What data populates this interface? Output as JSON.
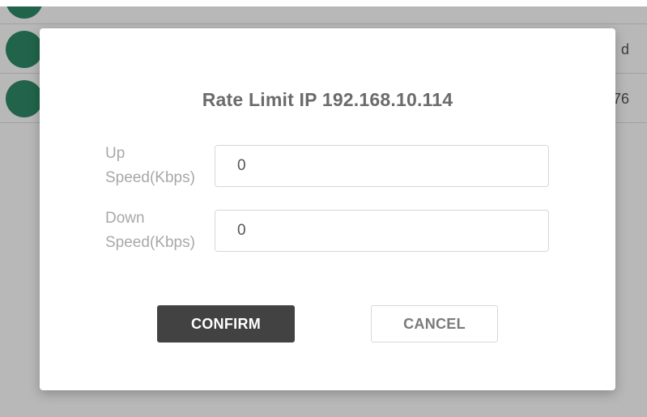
{
  "background_list": {
    "rows": [
      {
        "trailing_text": ""
      },
      {
        "trailing_text": "d"
      },
      {
        "trailing_text": "76"
      }
    ]
  },
  "dialog": {
    "title": "Rate Limit IP 192.168.10.114",
    "fields": [
      {
        "label": "Up\nSpeed(Kbps)",
        "value": "0"
      },
      {
        "label": "Down\nSpeed(Kbps)",
        "value": "0"
      }
    ],
    "confirm_label": "CONFIRM",
    "cancel_label": "CANCEL"
  },
  "colors": {
    "avatar": "#2e8b68",
    "confirm_bg": "#424242",
    "title_text": "#6b6b6b",
    "label_text": "#a8a8a8"
  }
}
